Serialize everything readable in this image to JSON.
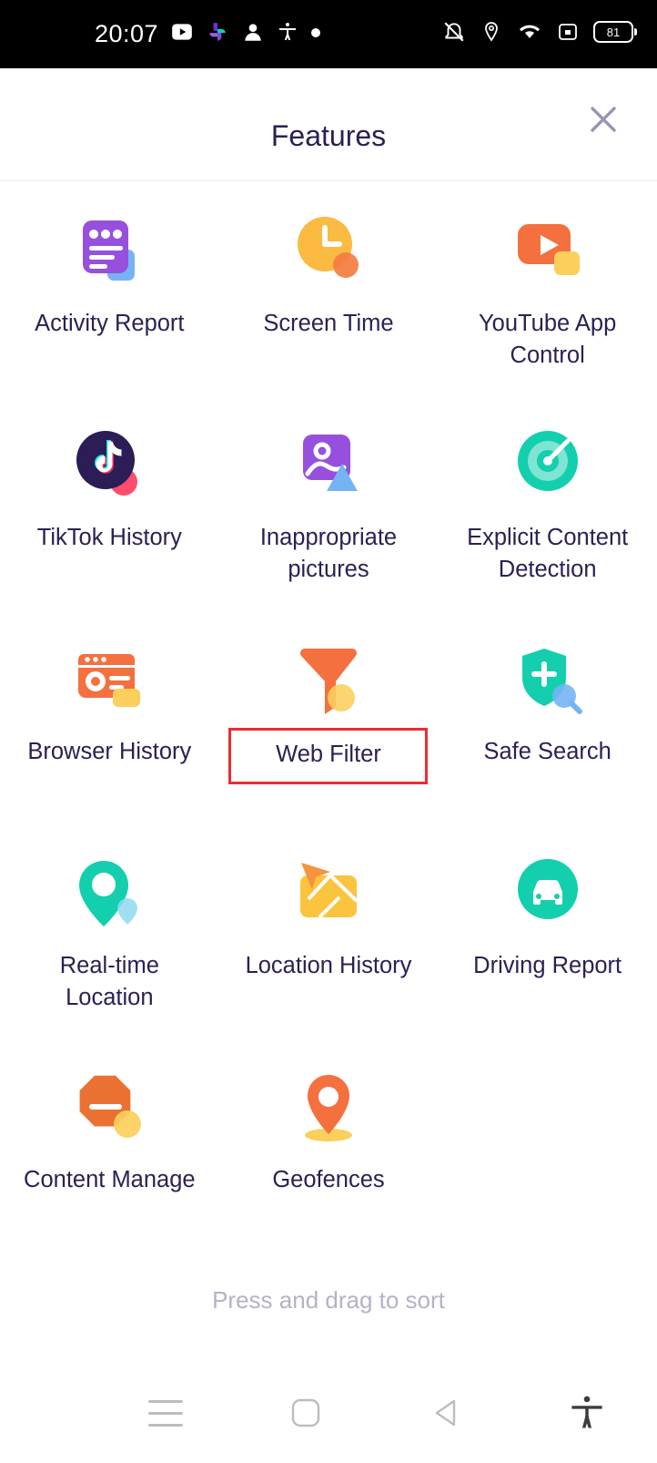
{
  "status_bar": {
    "time": "20:07",
    "left_icons": [
      "youtube-icon",
      "google-photos-icon",
      "contact-icon",
      "accessibility-icon",
      "dot-indicator"
    ],
    "right_icons": [
      "ringer-mute-icon",
      "location-icon",
      "wifi-icon",
      "screen-record-icon"
    ],
    "battery_level": "81"
  },
  "header": {
    "title": "Features",
    "close_label": "close-icon"
  },
  "features": [
    {
      "label": "Activity Report",
      "icon": "activity-report-icon",
      "highlighted": false
    },
    {
      "label": "Screen Time",
      "icon": "screen-time-icon",
      "highlighted": false
    },
    {
      "label": "YouTube App Control",
      "icon": "youtube-app-control-icon",
      "highlighted": false
    },
    {
      "label": "TikTok History",
      "icon": "tiktok-history-icon",
      "highlighted": false
    },
    {
      "label": "Inappropriate pictures",
      "icon": "inappropriate-pictures-icon",
      "highlighted": false
    },
    {
      "label": "Explicit Content Detection",
      "icon": "explicit-content-detection-icon",
      "highlighted": false
    },
    {
      "label": "Browser History",
      "icon": "browser-history-icon",
      "highlighted": false
    },
    {
      "label": "Web Filter",
      "icon": "web-filter-icon",
      "highlighted": true
    },
    {
      "label": "Safe Search",
      "icon": "safe-search-icon",
      "highlighted": false
    },
    {
      "label": "Real-time Location",
      "icon": "real-time-location-icon",
      "highlighted": false
    },
    {
      "label": "Location History",
      "icon": "location-history-icon",
      "highlighted": false
    },
    {
      "label": "Driving Report",
      "icon": "driving-report-icon",
      "highlighted": false
    },
    {
      "label": "Content Manage",
      "icon": "content-manage-icon",
      "highlighted": false
    },
    {
      "label": "Geofences",
      "icon": "geofences-icon",
      "highlighted": false
    }
  ],
  "footer": {
    "sort_hint": "Press and drag to sort"
  },
  "nav_bar": {
    "items": [
      "menu-icon",
      "home-icon",
      "back-icon",
      "accessibility-icon"
    ]
  },
  "colors": {
    "highlight_border": "#ee2b33",
    "title_text": "#2a2152",
    "hint_text": "#b4b2c6",
    "purple": "#9750dd",
    "amber": "#fbba42",
    "orange": "#f4703f",
    "teal": "#13cfae",
    "blue": "#74b4f5",
    "pink": "#ff4d6d",
    "yellow": "#fbcf5c"
  }
}
